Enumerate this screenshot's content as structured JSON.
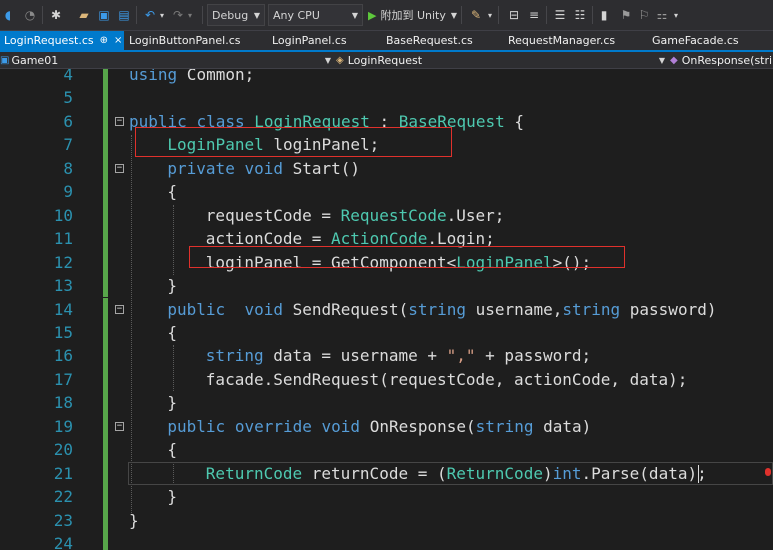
{
  "toolbar": {
    "config": "Debug",
    "platform": "Any CPU",
    "attach_label": "附加到 Unity",
    "icons": [
      "back-icon",
      "forward-icon",
      "new-project-icon",
      "open-file-icon",
      "save-icon",
      "save-all-icon",
      "undo-icon",
      "redo-icon",
      "play-icon",
      "bookmark-icon"
    ]
  },
  "tabs": [
    {
      "label": "LoginRequest.cs",
      "active": true,
      "pin": "⊕",
      "close": "×"
    },
    {
      "label": "LoginButtonPanel.cs"
    },
    {
      "label": "LoginPanel.cs"
    },
    {
      "label": "BaseRequest.cs"
    },
    {
      "label": "RequestManager.cs"
    },
    {
      "label": "GameFacade.cs"
    }
  ],
  "navbar": {
    "project": "Game01",
    "class": "LoginRequest",
    "member": "OnResponse(strin"
  },
  "code_lines": [
    {
      "n": "4"
    },
    {
      "n": "5"
    },
    {
      "n": "6"
    },
    {
      "n": "7"
    },
    {
      "n": "8"
    },
    {
      "n": "9"
    },
    {
      "n": "10"
    },
    {
      "n": "11"
    },
    {
      "n": "12"
    },
    {
      "n": "13"
    },
    {
      "n": "14"
    },
    {
      "n": "15"
    },
    {
      "n": "16"
    },
    {
      "n": "17"
    },
    {
      "n": "18"
    },
    {
      "n": "19"
    },
    {
      "n": "20"
    },
    {
      "n": "21"
    },
    {
      "n": "22"
    },
    {
      "n": "23"
    },
    {
      "n": "24"
    }
  ],
  "code": {
    "l4": [
      "using",
      " Common;"
    ],
    "l6": [
      "public",
      " ",
      "class",
      " ",
      "LoginRequest",
      " : ",
      "BaseRequest",
      " {"
    ],
    "l7": [
      "LoginPanel",
      " loginPanel;"
    ],
    "l8": [
      "private",
      " ",
      "void",
      " Start()"
    ],
    "l9": [
      "{"
    ],
    "l10": [
      "requestCode = ",
      "RequestCode",
      ".User;"
    ],
    "l11": [
      "actionCode = ",
      "ActionCode",
      ".Login;"
    ],
    "l12": [
      "loginPanel = GetComponent<",
      "LoginPanel",
      ">();"
    ],
    "l13": [
      "}"
    ],
    "l14": [
      "public",
      "  ",
      "void",
      " SendRequest(",
      "string",
      " username,",
      "string",
      " password)"
    ],
    "l15": [
      "{"
    ],
    "l16": [
      "string",
      " data = username + ",
      "\",\"",
      " + password;"
    ],
    "l17": [
      "facade.SendRequest(requestCode, actionCode, data);"
    ],
    "l18": [
      "}"
    ],
    "l19": [
      "public",
      " ",
      "override",
      " ",
      "void",
      " OnResponse(",
      "string",
      " data)"
    ],
    "l20": [
      "{"
    ],
    "l21": [
      "ReturnCode",
      " returnCode = (",
      "ReturnCode",
      ")",
      "int",
      ".Parse(data);"
    ],
    "l22": [
      "}"
    ],
    "l23": [
      "}"
    ]
  },
  "fold_minus": "−",
  "colors": {
    "keyword": "#569cd6",
    "type": "#4ec9b0",
    "string": "#d69d85",
    "text": "#dcdcdc",
    "line_number": "#2b91af",
    "highlight": "#e0312c",
    "tab_active": "#007acc",
    "changed": "#57a64a"
  }
}
